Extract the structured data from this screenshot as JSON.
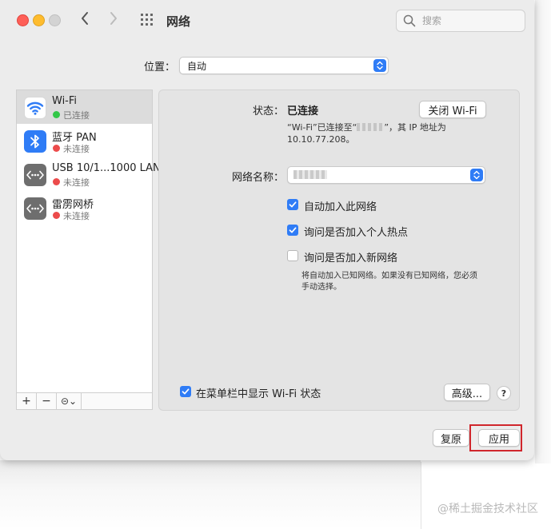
{
  "window": {
    "title": "网络"
  },
  "search": {
    "placeholder": "搜索"
  },
  "location": {
    "label": "位置：",
    "value": "自动"
  },
  "sidebar": {
    "items": [
      {
        "name": "Wi-Fi",
        "status": "已连接",
        "status_color": "#33c748",
        "icon": "wifi-icon"
      },
      {
        "name": "蓝牙 PAN",
        "status": "未连接",
        "status_color": "#ec4b4b",
        "icon": "bluetooth-icon"
      },
      {
        "name": "USB 10/1...1000 LAN",
        "status": "未连接",
        "status_color": "#ec4b4b",
        "icon": "ethernet-icon"
      },
      {
        "name": "雷雳网桥",
        "status": "未连接",
        "status_color": "#ec4b4b",
        "icon": "ethernet-icon"
      }
    ],
    "toolbar": {
      "add": "+",
      "remove": "−",
      "action": "⊝⌄"
    }
  },
  "detail": {
    "status_label": "状态：",
    "status_value": "已连接",
    "turn_off_button": "关闭 Wi-Fi",
    "status_desc_line1_a": "“Wi-Fi”已连接至“",
    "status_desc_line1_b": "”，其 IP 地址为",
    "status_desc_line2": "10.10.77.208。",
    "network_name_label": "网络名称：",
    "checkboxes": [
      {
        "label": "自动加入此网络",
        "checked": true
      },
      {
        "label": "询问是否加入个人热点",
        "checked": true
      },
      {
        "label": "询问是否加入新网络",
        "checked": false
      }
    ],
    "ask_desc_line1": "将自动加入已知网络。如果没有已知网络，您必须",
    "ask_desc_line2": "手动选择。",
    "menubar_checkbox": {
      "label": "在菜单栏中显示 Wi-Fi 状态",
      "checked": true
    },
    "advanced_button": "高级...",
    "help_button": "?"
  },
  "footer": {
    "revert_button": "复原",
    "apply_button": "应用"
  },
  "watermark": "@稀土掘金技术社区",
  "colors": {
    "accent": "#2f7cf6",
    "highlight": "#d0262c"
  }
}
